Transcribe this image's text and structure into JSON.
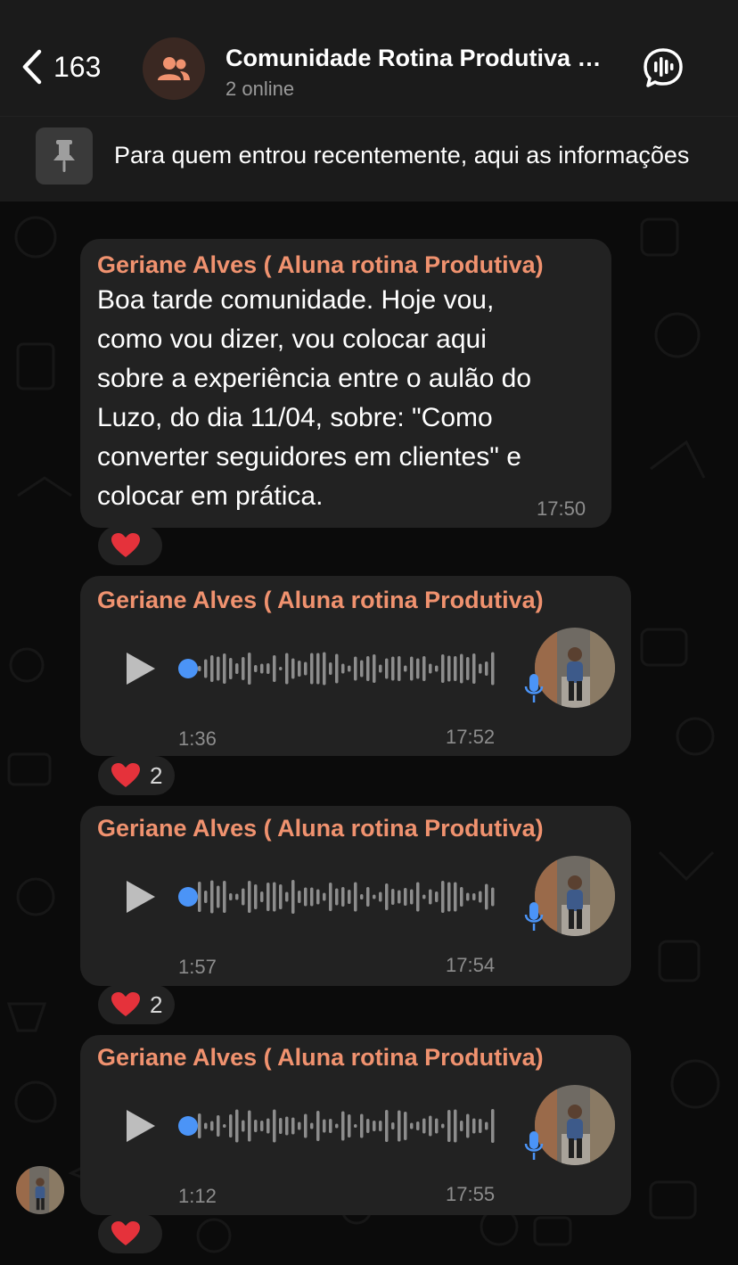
{
  "header": {
    "back_count": "163",
    "title": "Comunidade Rotina Produtiva Comunidade",
    "subtitle": "2 online"
  },
  "pinned": {
    "text": "Para quem entrou recentemente, aqui as informações"
  },
  "messages": [
    {
      "sender": "Geriane Alves ( Aluna rotina Produtiva)",
      "type": "text",
      "lines": [
        "Boa tarde comunidade. Hoje vou,",
        "como vou dizer, vou colocar aqui",
        "sobre a experiência entre o aulão do",
        "Luzo, do dia 11/04, sobre: \"Como",
        "converter seguidores em clientes\" e",
        "colocar em prática."
      ],
      "time": "17:50",
      "reaction": {
        "emoji": "heart",
        "count": ""
      }
    },
    {
      "sender": "Geriane Alves ( Aluna rotina Produtiva)",
      "type": "voice",
      "duration": "1:36",
      "time": "17:52",
      "reaction": {
        "emoji": "heart",
        "count": "2"
      }
    },
    {
      "sender": "Geriane Alves ( Aluna rotina Produtiva)",
      "type": "voice",
      "duration": "1:57",
      "time": "17:54",
      "reaction": {
        "emoji": "heart",
        "count": "2"
      }
    },
    {
      "sender": "Geriane Alves ( Aluna rotina Produtiva)",
      "type": "voice",
      "duration": "1:12",
      "time": "17:55",
      "reaction": {
        "emoji": "heart",
        "count": ""
      }
    }
  ],
  "colors": {
    "sender": "#f0926f",
    "bubble": "#222222",
    "accent_blue": "#4b94f7",
    "heart": "#e5323b"
  },
  "icons": [
    "chevron-left-icon",
    "group-icon",
    "voice-chat-icon",
    "pin-icon",
    "play-icon",
    "mic-icon",
    "heart-icon"
  ]
}
